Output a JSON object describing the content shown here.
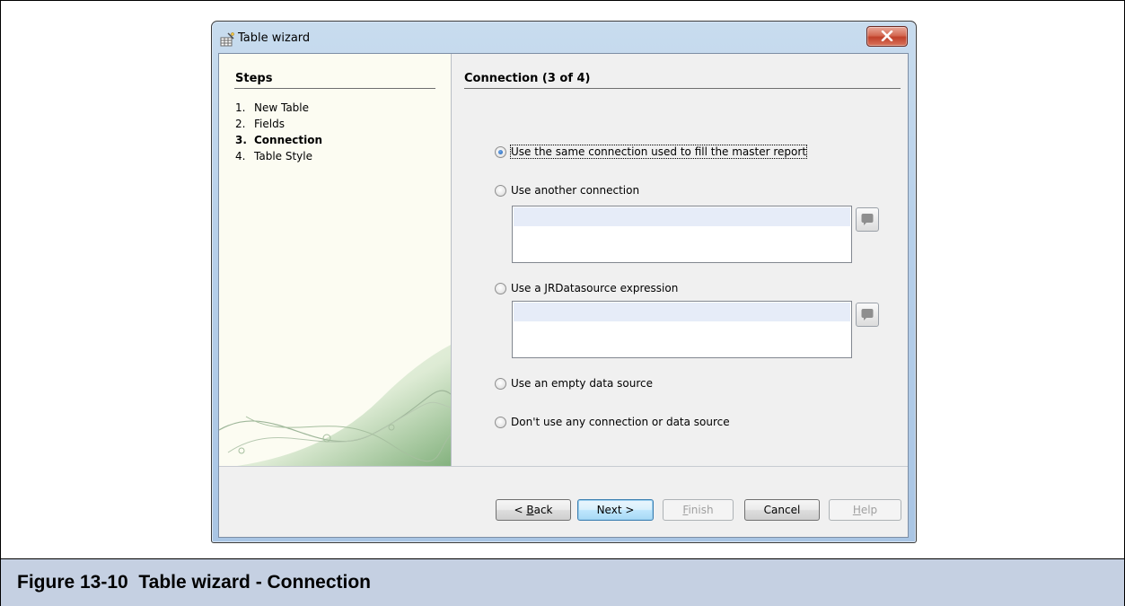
{
  "window": {
    "title": "Table wizard"
  },
  "steps": {
    "title": "Steps",
    "items": [
      {
        "num": "1.",
        "label": "New Table",
        "current": false
      },
      {
        "num": "2.",
        "label": "Fields",
        "current": false
      },
      {
        "num": "3.",
        "label": "Connection",
        "current": true
      },
      {
        "num": "4.",
        "label": "Table Style",
        "current": false
      }
    ]
  },
  "panel": {
    "title": "Connection (3 of 4)",
    "options": [
      {
        "label": "Use the same connection used to fill the master report",
        "checked": true
      },
      {
        "label": "Use another connection",
        "checked": false
      },
      {
        "label": "Use a JRDatasource expression",
        "checked": false
      },
      {
        "label": "Use an empty data source",
        "checked": false
      },
      {
        "label": "Don't use any connection or data source",
        "checked": false
      }
    ]
  },
  "buttons": {
    "back_pre": "< ",
    "back_mnemonic": "B",
    "back_post": "ack",
    "next": "Next >",
    "finish_mnemonic": "F",
    "finish_post": "inish",
    "cancel": "Cancel",
    "help_mnemonic": "H",
    "help_post": "elp"
  },
  "caption": "Figure 13-10  Table wizard - Connection"
}
